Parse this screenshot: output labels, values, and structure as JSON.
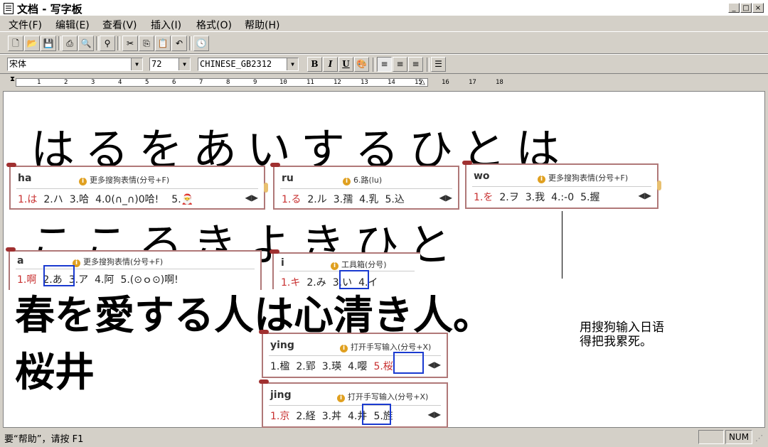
{
  "window": {
    "title": "文档 - 写字板",
    "min": "_",
    "max": "□",
    "close": "×"
  },
  "menu": [
    "文件(F)",
    "编辑(E)",
    "查看(V)",
    "插入(I)",
    "格式(O)",
    "帮助(H)"
  ],
  "toolbar": {
    "new": "new-icon",
    "open": "open-icon",
    "save": "save-icon",
    "print": "print-icon",
    "preview": "preview-icon",
    "find": "find-icon",
    "cut": "cut-icon",
    "copy": "copy-icon",
    "paste": "paste-icon",
    "undo": "undo-icon",
    "datetime": "datetime-icon"
  },
  "format": {
    "font": "宋体",
    "size": "72",
    "script": "CHINESE_GB2312",
    "bold": "B",
    "italic": "I",
    "underline": "U"
  },
  "ruler": {
    "ticks": [
      "1",
      "2",
      "3",
      "4",
      "5",
      "6",
      "7",
      "8",
      "9",
      "10",
      "11",
      "12",
      "13",
      "14",
      "15",
      "16",
      "17",
      "18"
    ]
  },
  "document": {
    "line1": "はるをあいするひとは",
    "line2": "こころきよきひと",
    "line3": "春を愛する人は心清き人。",
    "line4": "桜井",
    "note_line1": "用搜狗输入日语",
    "note_line2": "得把我累死。"
  },
  "ime_popups": [
    {
      "pinyin": "ha",
      "hint": "更多搜狗表情(分号+F)",
      "candidates": [
        "1.は",
        "2.ハ",
        "3.哈",
        "4.0(∩_∩)0哈!",
        "5.🎅"
      ]
    },
    {
      "pinyin": "ru",
      "hint": "6.路(lu)",
      "candidates": [
        "1.る",
        "2.ル",
        "3.孺",
        "4.乳",
        "5.込"
      ]
    },
    {
      "pinyin": "wo",
      "hint": "更多搜狗表情(分号+F)",
      "candidates": [
        "1.を",
        "2.ヲ",
        "3.我",
        "4.:-0",
        "5.握"
      ]
    },
    {
      "pinyin": "a",
      "hint": "更多搜狗表情(分号+F)",
      "candidates": [
        "1.啊",
        "2.あ",
        "3.ア",
        "4.阿",
        "5.(⊙ｏ⊙)啊!"
      ]
    },
    {
      "pinyin": "i",
      "hint": "工具箱(分号)",
      "candidates": [
        "1.キ",
        "2.み",
        "3.い",
        "4.イ"
      ]
    },
    {
      "pinyin": "ying",
      "hint": "打开手写输入(分号+X)",
      "candidates": [
        "1.楹",
        "2.郢",
        "3.瑛",
        "4.嘤",
        "5.桜"
      ]
    },
    {
      "pinyin": "jing",
      "hint": "打开手写输入(分号+X)",
      "candidates": [
        "1.京",
        "2.経",
        "3.丼",
        "4.井",
        "5.旌"
      ]
    }
  ],
  "status": {
    "help": "要“帮助”，请按 F1",
    "num": "NUM"
  }
}
